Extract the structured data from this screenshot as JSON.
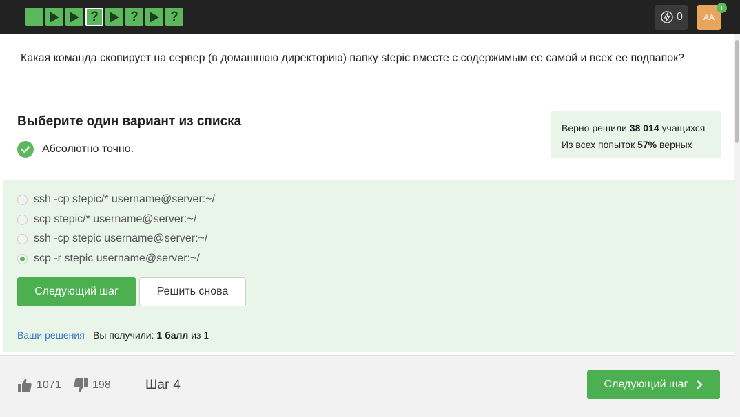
{
  "topbar": {
    "steps": [
      {
        "type": "empty",
        "label": ""
      },
      {
        "type": "video",
        "label": ""
      },
      {
        "type": "video",
        "label": ""
      },
      {
        "type": "quiz",
        "label": "?"
      },
      {
        "type": "video",
        "label": ""
      },
      {
        "type": "quiz",
        "label": "?"
      },
      {
        "type": "video",
        "label": ""
      },
      {
        "type": "quiz",
        "label": "?"
      }
    ],
    "energy_count": "0",
    "avatar_initials": "AA",
    "notification_count": "1"
  },
  "question": {
    "text": "Какая команда скопирует на сервер (в домашнюю директорию) папку stepic вместе с содержимым ее самой и всех ее подпапок?"
  },
  "task": {
    "title": "Выберите один вариант из списка",
    "feedback": "Абсолютно точно."
  },
  "stats": {
    "line1_prefix": "Верно решили ",
    "line1_count": "38 014",
    "line1_suffix": " учащихся",
    "line2_prefix": "Из всех попыток ",
    "line2_percent": "57%",
    "line2_suffix": " верных"
  },
  "options": [
    {
      "text": "ssh -cp stepic/* username@server:~/",
      "selected": false
    },
    {
      "text": "scp stepic/* username@server:~/",
      "selected": false
    },
    {
      "text": "ssh -cp stepic username@server:~/",
      "selected": false
    },
    {
      "text": "scp -r stepic username@server:~/",
      "selected": true
    }
  ],
  "actions": {
    "next_label": "Следующий шаг",
    "retry_label": "Решить снова",
    "solutions_link": "Ваши решения",
    "score_prefix": "Вы получили: ",
    "score_value": "1 балл",
    "score_suffix": " из 1"
  },
  "footer": {
    "likes": "1071",
    "dislikes": "198",
    "step_label": "Шаг 4",
    "next_label": "Следующий шаг"
  },
  "colors": {
    "accent": "#4caf50",
    "success_bg": "#e9f5e9",
    "topbar": "#222222"
  }
}
